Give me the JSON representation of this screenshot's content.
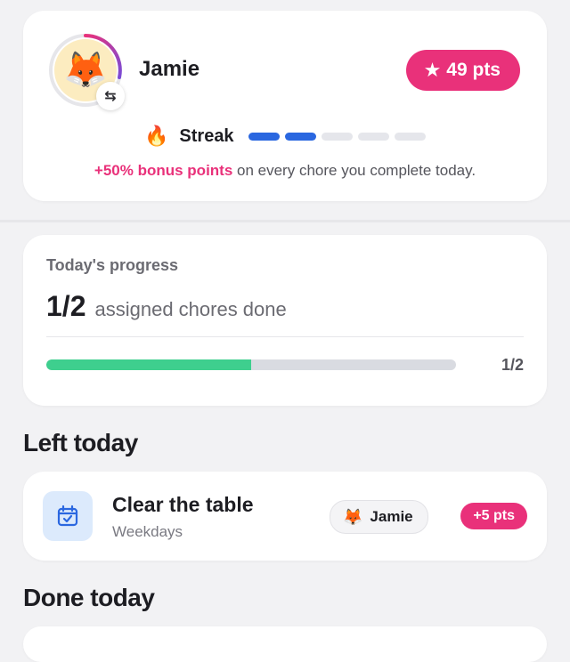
{
  "profile": {
    "avatar_emoji": "🦊",
    "name": "Jamie",
    "points_label": "49 pts",
    "star_icon": "star-icon",
    "swap_icon": "⇆",
    "streak_icon": "🔥",
    "streak_label": "Streak",
    "streak_total": 5,
    "streak_filled": 2,
    "bonus_highlight": "+50% bonus points",
    "bonus_rest": " on every chore you complete today."
  },
  "progress": {
    "title": "Today's progress",
    "count": "1/2",
    "description": "assigned chores done",
    "fraction": 0.5,
    "bar_label": "1/2"
  },
  "sections": {
    "left_today": "Left today",
    "done_today": "Done today"
  },
  "chores": [
    {
      "name": "Clear the table",
      "schedule": "Weekdays",
      "assignee_emoji": "🦊",
      "assignee": "Jamie",
      "reward": "+5 pts",
      "icon": "calendar-check-icon"
    }
  ],
  "colors": {
    "accent_pink": "#e9317a",
    "streak_blue": "#2a67e0",
    "progress_green": "#3ecf8e",
    "ring_gradient_start": "#e9317a",
    "ring_gradient_end": "#7b4bd6"
  }
}
